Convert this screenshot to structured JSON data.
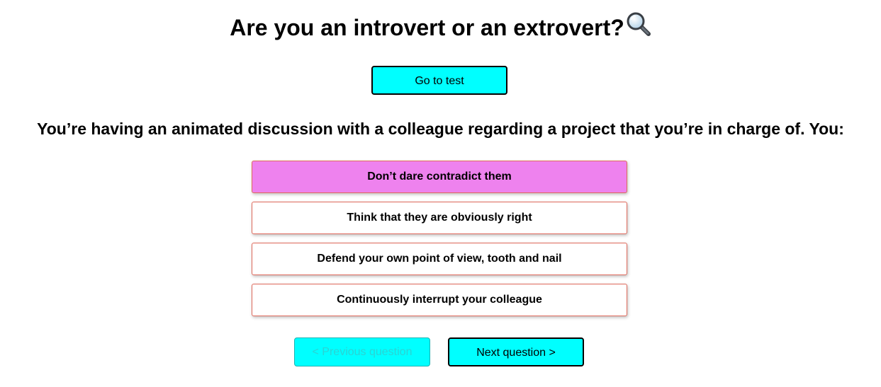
{
  "header": {
    "title": "Are you an introvert or an extrovert?",
    "title_icon": "magnifying-glass-icon"
  },
  "go_to_test_label": "Go to test",
  "question": {
    "text": "You’re having an animated discussion with a colleague regarding a project that you’re in charge of. You:",
    "answers": [
      {
        "label": "Don’t dare contradict them",
        "selected": true
      },
      {
        "label": "Think that they are obviously right",
        "selected": false
      },
      {
        "label": "Defend your own point of view, tooth and nail",
        "selected": false
      },
      {
        "label": "Continuously interrupt your colleague",
        "selected": false
      }
    ]
  },
  "navigation": {
    "previous_label": "< Previous question",
    "previous_disabled": true,
    "next_label": "Next question >"
  },
  "colors": {
    "button_bg": "#00ffff",
    "selected_answer_bg": "#ee82ee",
    "answer_border": "#e06a5c"
  }
}
